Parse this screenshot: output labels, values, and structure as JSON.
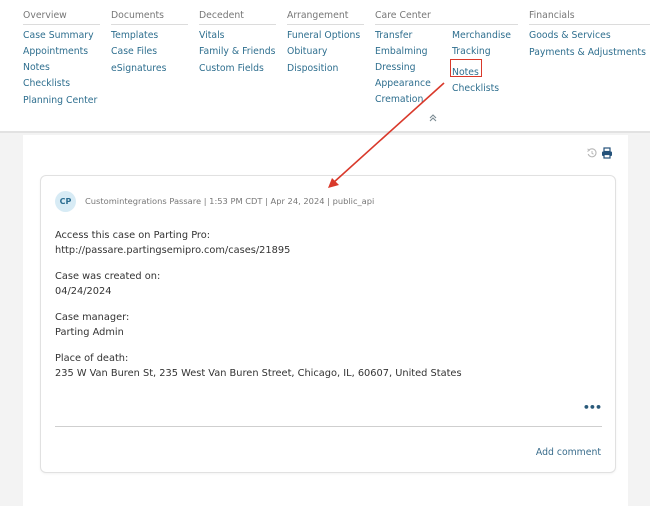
{
  "nav": {
    "overview": {
      "title": "Overview",
      "items": [
        "Case Summary",
        "Appointments",
        "Notes",
        "Checklists",
        "Planning Center"
      ]
    },
    "documents": {
      "title": "Documents",
      "items": [
        "Templates",
        "Case Files",
        "eSignatures"
      ]
    },
    "decedent": {
      "title": "Decedent",
      "items": [
        "Vitals",
        "Family & Friends",
        "Custom Fields"
      ]
    },
    "arrangement": {
      "title": "Arrangement",
      "items": [
        "Funeral Options",
        "Obituary",
        "Disposition"
      ]
    },
    "care_center": {
      "title": "Care Center",
      "items_col1": [
        "Transfer",
        "Embalming",
        "Dressing",
        "Appearance",
        "Cremation"
      ],
      "items_col2": [
        "Merchandise",
        "Tracking",
        "Notes",
        "Checklists"
      ],
      "highlighted": "Notes"
    },
    "financials": {
      "title": "Financials",
      "items": [
        "Goods & Services",
        "Payments & Adjustments"
      ]
    },
    "collapse_icon": "double-chevron-up-icon"
  },
  "toolbar": {
    "history_icon": "history-icon",
    "print_icon": "print-icon"
  },
  "note": {
    "avatar_initials": "CP",
    "author": "Customintegrations Passare",
    "time": "1:53 PM CDT",
    "date": "Apr 24, 2024",
    "source": "public_api",
    "meta_line": "Customintegrations Passare | 1:53 PM CDT | Apr 24, 2024 | public_api",
    "paragraphs": [
      [
        "Access this case on Parting Pro:",
        "http://passare.partingsemipro.com/cases/21895"
      ],
      [
        "Case was created on:",
        "04/24/2024"
      ],
      [
        "Case manager:",
        "Parting Admin"
      ],
      [
        "Place of death:",
        "235 W Van Buren St, 235 West Van Buren Street, Chicago, IL, 60607, United States"
      ]
    ],
    "more_label": "•••",
    "add_comment_label": "Add comment"
  },
  "annotation": {
    "color": "#d9392b",
    "description": "arrow from highlighted Care Center Notes link to note header"
  }
}
